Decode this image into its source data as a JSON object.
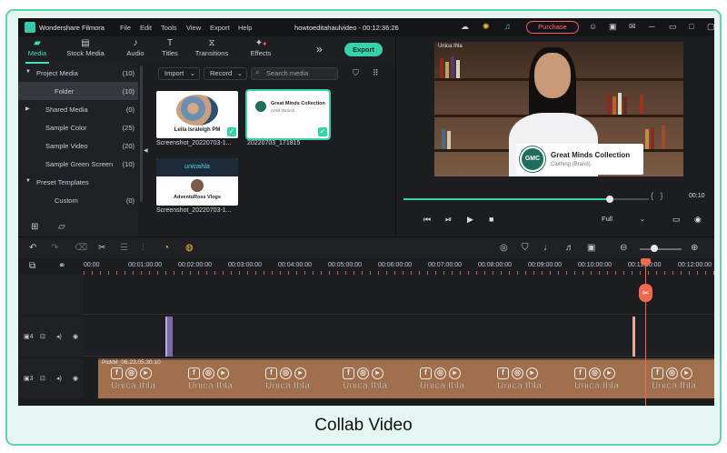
{
  "app": {
    "name": "Wondershare Filmora",
    "menu": [
      "File",
      "Edit",
      "Tools",
      "View",
      "Export",
      "Help"
    ],
    "project_title": "howtoeditahaulvideo - 00:12:36:26",
    "purchase_label": "Purchase"
  },
  "tabs": [
    {
      "label": "Media",
      "icon": "folder-icon"
    },
    {
      "label": "Stock Media",
      "icon": "stock-media-icon"
    },
    {
      "label": "Audio",
      "icon": "music-note-icon"
    },
    {
      "label": "Titles",
      "icon": "text-t-icon"
    },
    {
      "label": "Transitions",
      "icon": "transitions-icon"
    },
    {
      "label": "Effects",
      "icon": "effects-sparkle-icon"
    }
  ],
  "export_label": "Export",
  "sidebar": {
    "items": [
      {
        "label": "Project Media",
        "count": "(10)"
      },
      {
        "label": "Folder",
        "count": "(10)"
      },
      {
        "label": "Shared Media",
        "count": "(0)"
      },
      {
        "label": "Sample Color",
        "count": "(25)"
      },
      {
        "label": "Sample Video",
        "count": "(20)"
      },
      {
        "label": "Sample Green Screen",
        "count": "(10)"
      },
      {
        "label": "Preset Templates",
        "count": ""
      },
      {
        "label": "Custom",
        "count": "(0)"
      }
    ]
  },
  "media_toolbar": {
    "import_label": "Import",
    "record_label": "Record",
    "search_placeholder": "Search media"
  },
  "media_items": [
    {
      "caption": "Screenshot_20220703-1...",
      "thumb_text": "Leila Israleigh PM"
    },
    {
      "caption": "20220703_171815",
      "thumb_text": "Great Minds Collection",
      "thumb_sub": "Artist (Brand)"
    },
    {
      "caption": "Screenshot_20220703-1...",
      "thumb_text": "AdventuRoss Vlogs",
      "banner_text": "unicaihla"
    }
  ],
  "preview": {
    "corner_text": "Unica Ihla",
    "lower_third_name": "Great Minds Collection",
    "lower_third_sub": "Clothing (Brand)",
    "logo_text": "GMC",
    "time_display": "00:10",
    "progress": 0.84,
    "quality_label": "Full"
  },
  "timeline": {
    "ruler_labels": [
      "00:00",
      "00:01:00:00",
      "00:02:00:00",
      "00:03:00:00",
      "00:04:00:00",
      "00:05:00:00",
      "00:06:00:00",
      "00:07:00:00",
      "00:08:00:00",
      "00:09:00:00",
      "00:10:00:00",
      "00:11:00:00",
      "00:12:00:00"
    ],
    "clip_title": "PickM_06.23.05.30.10",
    "clip_watermark": "Unica Ihla",
    "zoom_level": 0.35
  },
  "caption": "Collab Video",
  "colors": {
    "accent": "#35d3ac",
    "playhead": "#f06a4e",
    "purchase": "#ff5a5a",
    "clip": "#a0704e"
  }
}
